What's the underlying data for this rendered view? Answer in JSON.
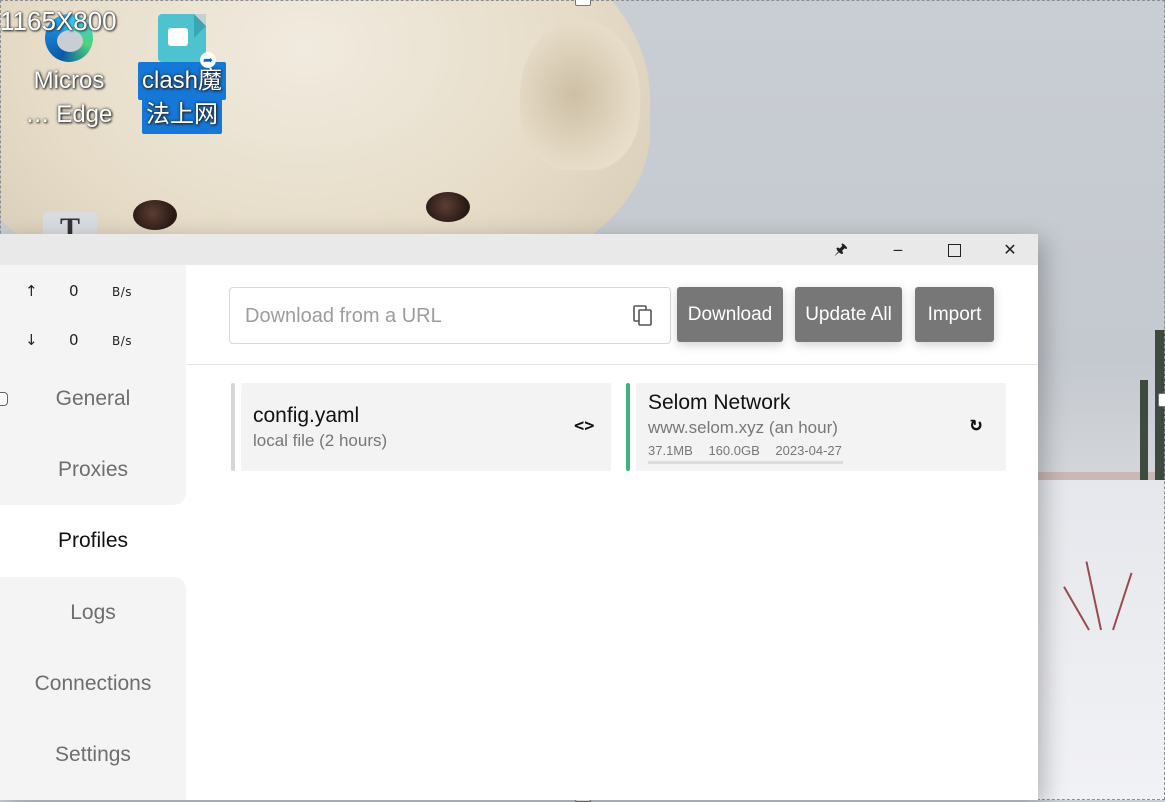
{
  "screen": {
    "size_label": "1165X800"
  },
  "desktop": {
    "icons": [
      {
        "label_line1": "Micros",
        "label_line2": "… Edge"
      },
      {
        "label_line1": "clash魔",
        "label_line2": "法上网"
      }
    ]
  },
  "window": {
    "titlebar": {
      "pin_glyph": "🖈",
      "minimize_glyph": "‒",
      "close_glyph": "✕"
    },
    "traffic": {
      "up": {
        "arrow": "↑",
        "value": "0",
        "unit": "B/s"
      },
      "down": {
        "arrow": "↓",
        "value": "0",
        "unit": "B/s"
      }
    },
    "nav": {
      "items": [
        {
          "label": "General"
        },
        {
          "label": "Proxies"
        },
        {
          "label": "Profiles"
        },
        {
          "label": "Logs"
        },
        {
          "label": "Connections"
        },
        {
          "label": "Settings"
        }
      ],
      "active": "Profiles"
    },
    "toolbar": {
      "url_placeholder": "Download from a URL",
      "url_value": "",
      "download_label": "Download",
      "update_all_label": "Update All",
      "import_label": "Import"
    },
    "profiles": [
      {
        "name": "config.yaml",
        "subtitle": "local file (2 hours)",
        "action_icon": "code-icon",
        "action_glyph": "<>",
        "selected": false,
        "bar_color": "#d6d6d6"
      },
      {
        "name": "Selom Network",
        "subtitle": "www.selom.xyz (an hour)",
        "used": "37.1MB",
        "total": "160.0GB",
        "expires": "2023-04-27",
        "usage_fraction": 0.0002,
        "action_icon": "refresh-icon",
        "action_glyph": "↻",
        "selected": true,
        "bar_color": "#3fb37f"
      }
    ]
  }
}
